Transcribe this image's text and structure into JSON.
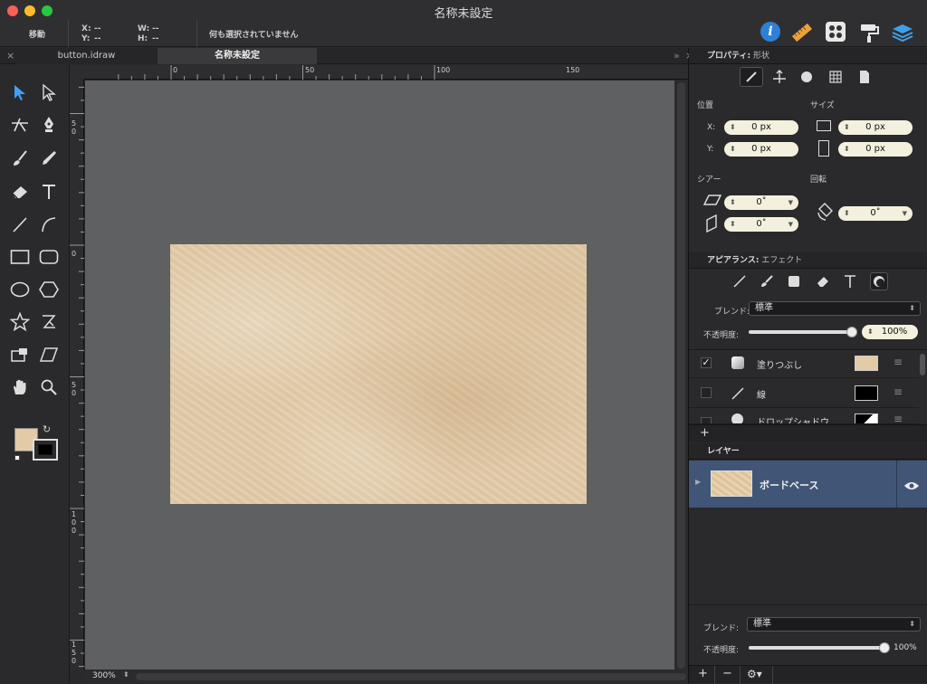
{
  "window": {
    "title": "名称未設定"
  },
  "toolbar": {
    "mode_label": "移動",
    "x_label": "X:",
    "x_value": "--",
    "y_label": "Y:",
    "y_value": "--",
    "w_label": "W:",
    "w_value": "--",
    "h_label": "H:",
    "h_value": "--",
    "selection_status": "何も選択されていません",
    "right_icons": [
      "info-icon",
      "ruler-icon",
      "grid-icon",
      "paint-roller-icon",
      "layers-icon"
    ]
  },
  "tabs": [
    {
      "label": "button.idraw",
      "active": false
    },
    {
      "label": "名称未設定",
      "active": true
    }
  ],
  "tab_overflow": "»",
  "ruler": {
    "top_ticks": [
      "0",
      "50",
      "100",
      "150"
    ],
    "left_ticks": [
      "50",
      "0",
      "50",
      "100",
      "150"
    ]
  },
  "status": {
    "zoom": "300%"
  },
  "properties": {
    "header_title": "プロパティ:",
    "header_sub": "形状",
    "position_label": "位置",
    "size_label": "サイズ",
    "x_label": "X:",
    "x_value": "0 px",
    "y_label": "Y:",
    "y_value": "0 px",
    "w_value": "0 px",
    "h_value": "0 px",
    "shear_label": "シアー",
    "rotation_label": "回転",
    "shear_x": "0˚",
    "shear_y": "0˚",
    "rotation": "0˚"
  },
  "appearance": {
    "header_title": "アピアランス:",
    "header_sub": "エフェクト",
    "blend_label": "ブレンド:",
    "blend_value": "標準",
    "opacity_label": "不透明度:",
    "opacity_value": "100%",
    "opacity": 1.0,
    "effects": [
      {
        "name": "塗りつぶし",
        "enabled": true,
        "color": "#e3cba8"
      },
      {
        "name": "線",
        "enabled": false,
        "color": "#000000"
      },
      {
        "name": "ドロップシャドウ",
        "enabled": false,
        "color": "#000000"
      }
    ],
    "add_label": "+"
  },
  "layers": {
    "header_title": "レイヤー",
    "items": [
      {
        "name": "ボードベース",
        "visible": true
      }
    ],
    "blend_label": "ブレンド:",
    "blend_value": "標準",
    "opacity_label": "不透明度:",
    "opacity_value": "100%",
    "opacity": 1.0,
    "add_label": "+",
    "remove_label": "−"
  },
  "colors": {
    "accent": "#2e7fd6",
    "layer_selected": "#415677",
    "fill_swatch": "#e3cba8"
  }
}
